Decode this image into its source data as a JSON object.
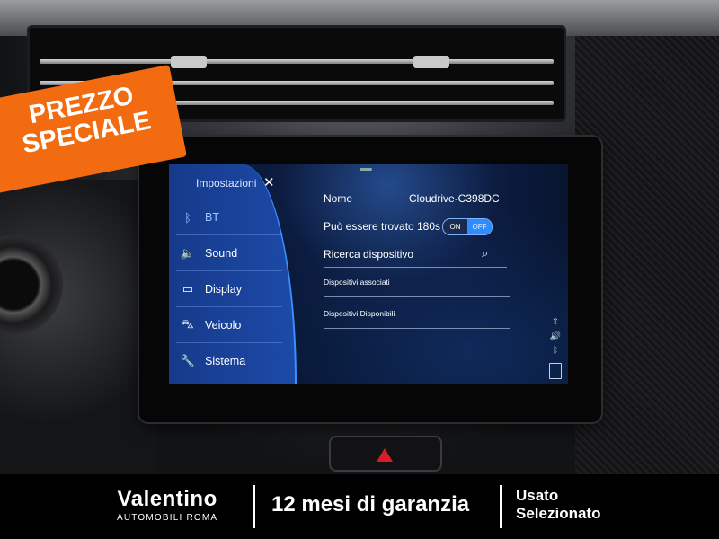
{
  "badge": {
    "line1": "PREZZO",
    "line2": "SPECIALE",
    "color": "#f26b10"
  },
  "screen": {
    "panel_title": "Impostazioni",
    "close_icon": "close-icon",
    "menu": [
      {
        "label": "BT",
        "icon": "bluetooth-icon",
        "active": true
      },
      {
        "label": "Sound",
        "icon": "speaker-icon"
      },
      {
        "label": "Display",
        "icon": "monitor-icon"
      },
      {
        "label": "Veicolo",
        "icon": "car-icon"
      },
      {
        "label": "Sistema",
        "icon": "wrench-icon"
      }
    ],
    "name_label": "Nome",
    "name_value": "Cloudrive-C398DC",
    "discoverable_label": "Può essere trovato",
    "discoverable_time": "180s",
    "toggle_on": "ON",
    "toggle_off": "OFF",
    "search_label": "Ricerca dispositivo",
    "search_icon": "search-icon",
    "paired_label": "Dispositivi associati",
    "available_label": "Dispositivi Disponibili",
    "status_icons": [
      "usb-icon",
      "volume-icon",
      "bluetooth-icon",
      "battery-icon"
    ]
  },
  "footer": {
    "brand_name": "Valentino",
    "brand_sub": "AUTOMOBILI ROMA",
    "warranty": "12 mesi di garanzia",
    "used_line1": "Usato",
    "used_line2": "Selezionato"
  }
}
